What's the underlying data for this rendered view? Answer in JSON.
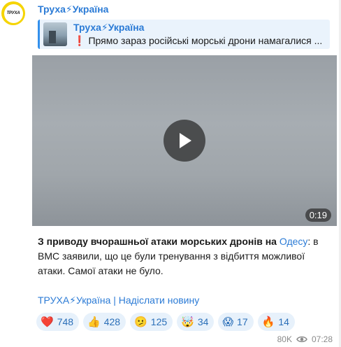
{
  "channel": {
    "avatar_text": "ТРУХА",
    "sender_name": "Труха⚡Україна"
  },
  "reply": {
    "title": "Труха⚡Україна",
    "excl": "❗",
    "text": "Прямо зараз російські морські дрони намагалися ..."
  },
  "media": {
    "duration": "0:19",
    "play_icon": "play-icon"
  },
  "message": {
    "bold": "З приводу вчорашньої атаки морських дронів на ",
    "link": "Одесу",
    "rest": ": в ВМС заявили, що це були тренування з відбиття можливої атаки. Самої атаки не було."
  },
  "footer": {
    "link_text": "ТРУХА⚡Україна | Надіслати новину"
  },
  "reactions": [
    {
      "emoji": "❤️",
      "count": "748"
    },
    {
      "emoji": "👍",
      "count": "428"
    },
    {
      "emoji": "🫤",
      "count": "125"
    },
    {
      "emoji": "🤯",
      "count": "34"
    },
    {
      "emoji": "😱",
      "count": "17"
    },
    {
      "emoji": "🔥",
      "count": "14"
    }
  ],
  "meta": {
    "views": "80K",
    "time": "07:28",
    "eye_icon": "eye-icon"
  }
}
